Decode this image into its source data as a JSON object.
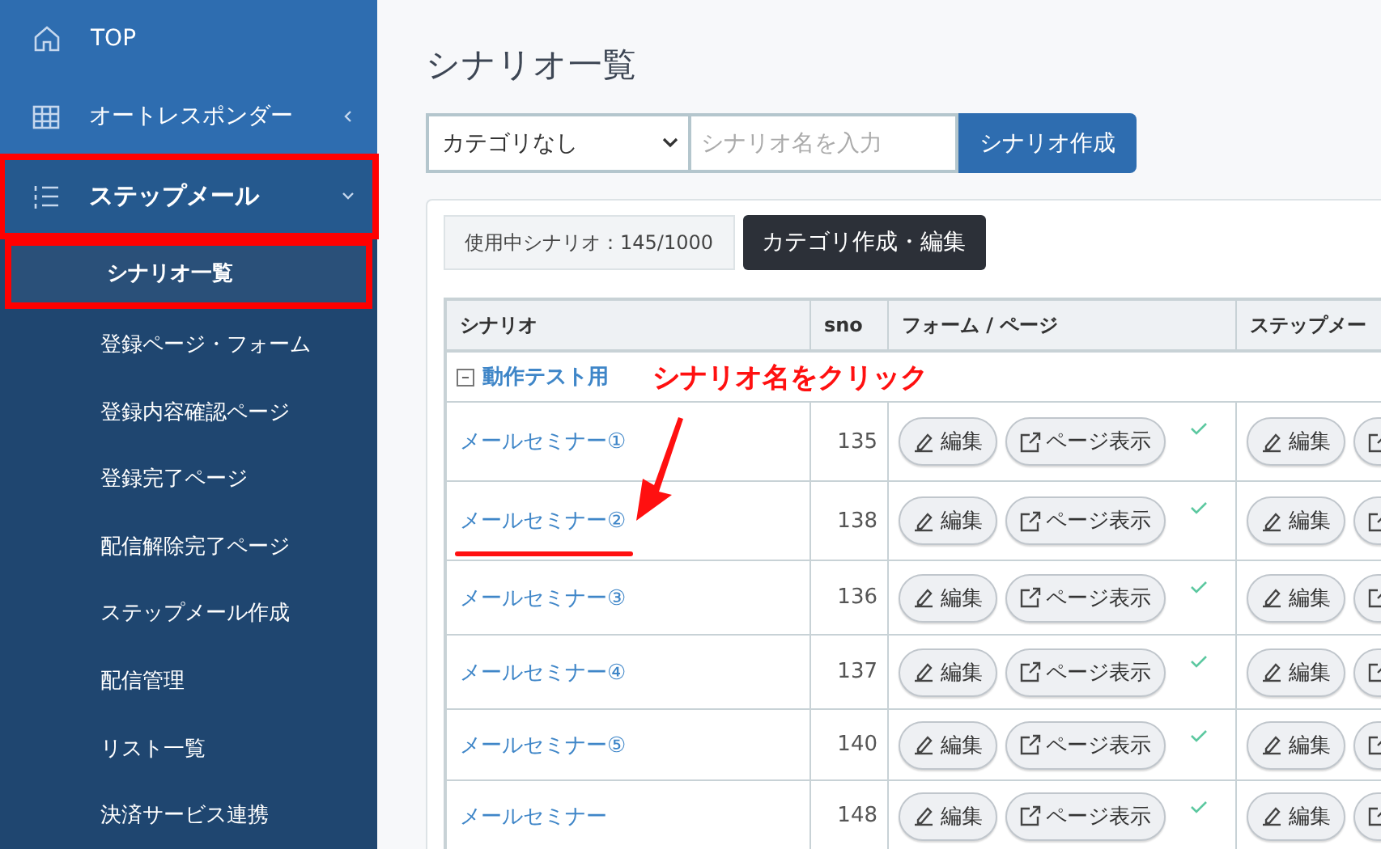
{
  "sidebar": {
    "items": [
      {
        "kind": "main",
        "label": "TOP",
        "selected": false,
        "highlighted": false
      },
      {
        "kind": "main",
        "label": "オートレスポンダー",
        "selected": false,
        "highlighted": false,
        "expanded": false
      },
      {
        "kind": "main",
        "label": "ステップメール",
        "selected": true,
        "highlighted": true,
        "expanded": true,
        "children": [
          {
            "label": "シナリオ一覧",
            "selected": true,
            "highlighted": true
          },
          {
            "label": "登録ページ・フォーム",
            "selected": false,
            "highlighted": false
          },
          {
            "label": "登録内容確認ページ",
            "selected": false,
            "highlighted": false
          },
          {
            "label": "登録完了ページ",
            "selected": false,
            "highlighted": false
          },
          {
            "label": "配信解除完了ページ",
            "selected": false,
            "highlighted": false
          },
          {
            "label": "ステップメール作成",
            "selected": false,
            "highlighted": false
          },
          {
            "label": "配信管理",
            "selected": false,
            "highlighted": false
          },
          {
            "label": "リスト一覧",
            "selected": false,
            "highlighted": false
          },
          {
            "label": "決済サービス連携",
            "selected": false,
            "highlighted": false
          }
        ]
      }
    ]
  },
  "page_title": "シナリオ一覧",
  "toolbar": {
    "category_select": "カテゴリなし",
    "name_field": {
      "placeholder": "シナリオ名を入力"
    },
    "create_button": "シナリオ作成"
  },
  "usage_badge": "使用中シナリオ：145/1000",
  "category_button": "カテゴリ作成・編集",
  "table": {
    "columns": [
      "シナリオ",
      "sno",
      "フォーム / ページ",
      "ステップメー"
    ],
    "groups": [
      {
        "name": "動作テスト用",
        "expanded": true,
        "rows": [
          {
            "name": "メールセミナー①",
            "sno": "135",
            "edit": "編集",
            "view": "ページ表示",
            "ok": true,
            "step_edit": "編集"
          },
          {
            "name": "メールセミナー②",
            "sno": "138",
            "edit": "編集",
            "view": "ページ表示",
            "ok": true,
            "step_edit": "編集",
            "underlined": true
          },
          {
            "name": "メールセミナー③",
            "sno": "136",
            "edit": "編集",
            "view": "ページ表示",
            "ok": true,
            "step_edit": "編集"
          },
          {
            "name": "メールセミナー④",
            "sno": "137",
            "edit": "編集",
            "view": "ページ表示",
            "ok": true,
            "step_edit": "編集"
          },
          {
            "name": "メールセミナー⑤",
            "sno": "140",
            "edit": "編集",
            "view": "ページ表示",
            "ok": true,
            "step_edit": "編集"
          },
          {
            "name": "メールセミナー",
            "sno": "148",
            "edit": "編集",
            "view": "ページ表示",
            "ok": true,
            "step_edit": "編集"
          }
        ]
      }
    ]
  },
  "annotation": {
    "text": "シナリオ名をクリック"
  }
}
